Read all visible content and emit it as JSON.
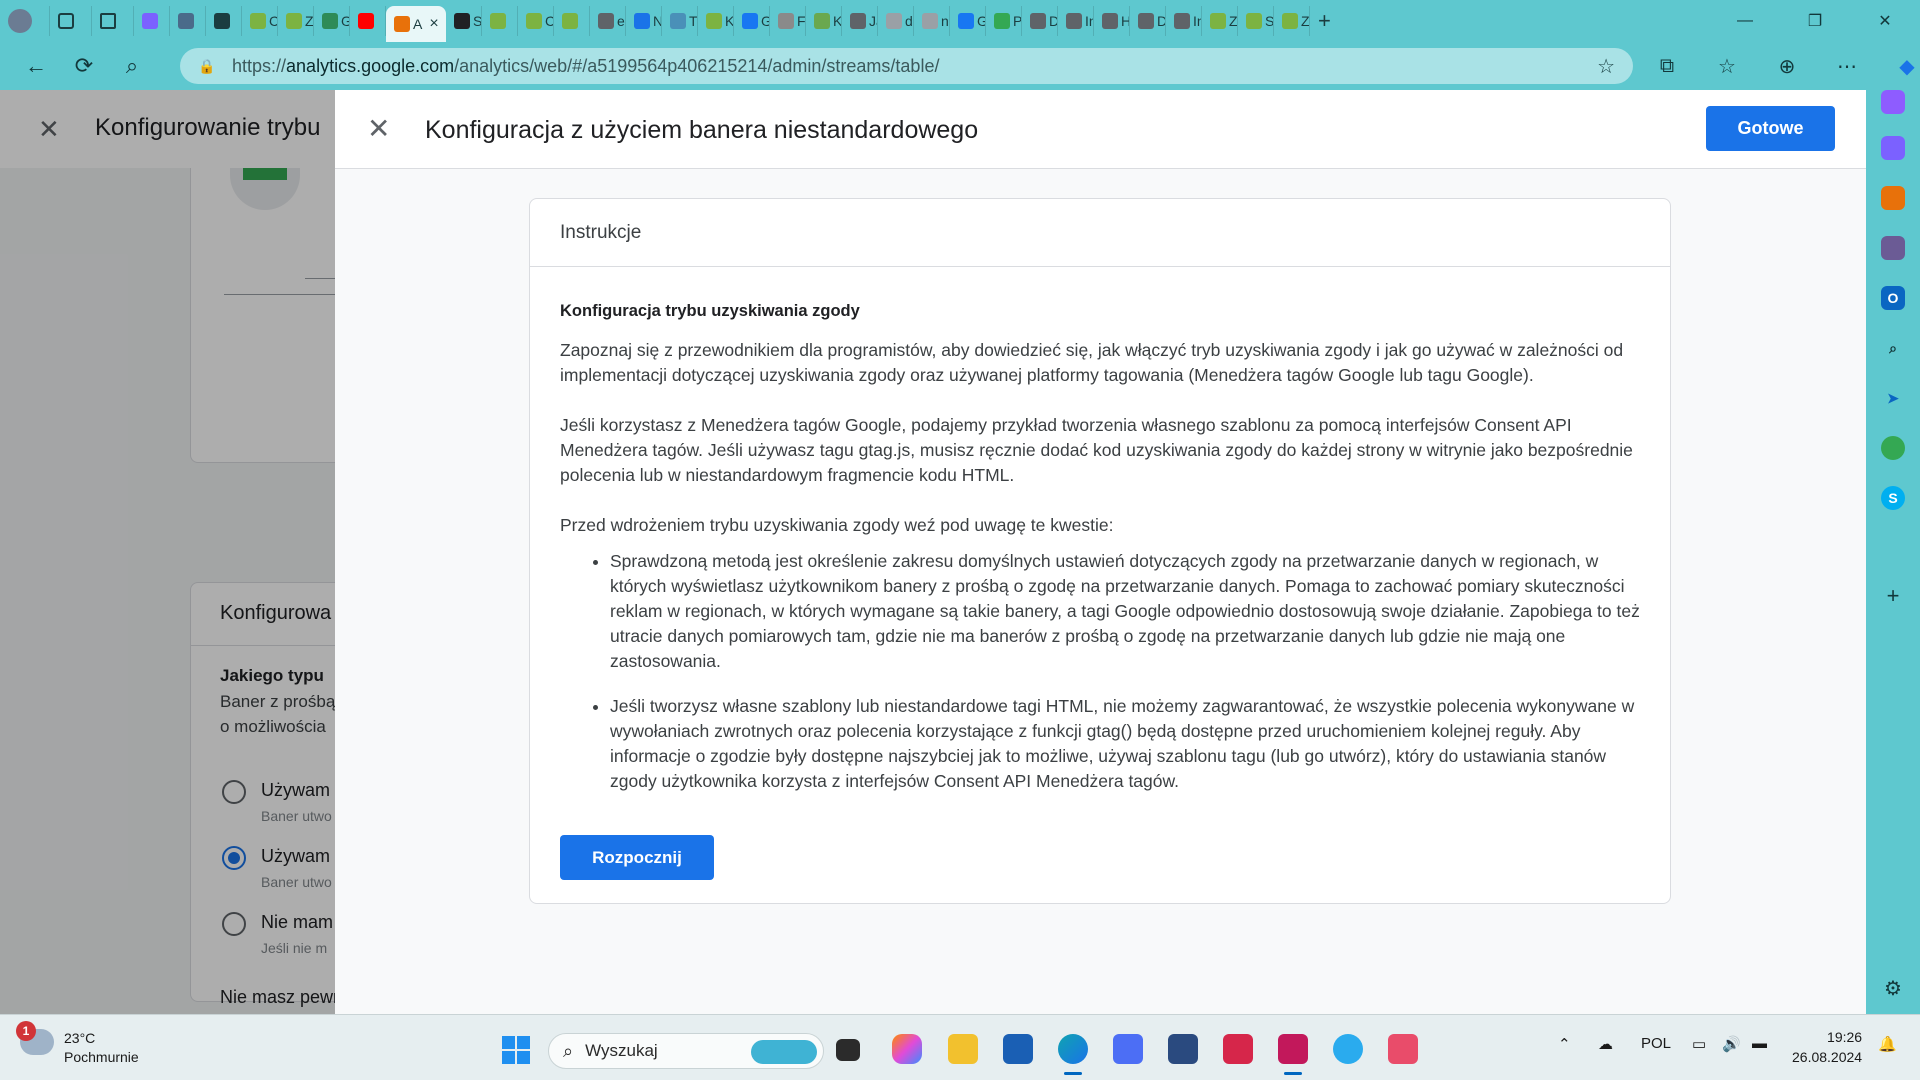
{
  "browser": {
    "url_prefix": "https://",
    "url_host": "analytics.google.com",
    "url_path": "/analytics/web/#/a5199564p406215214/admin/streams/table/",
    "tabs": [
      {
        "label": "",
        "color": "#7b61ff"
      },
      {
        "label": "",
        "color": "#4a6b8a"
      },
      {
        "label": "",
        "color": "#1b3d40"
      },
      {
        "label": "C",
        "color": "#7cb342"
      },
      {
        "label": "Z",
        "color": "#7cb342"
      },
      {
        "label": "G",
        "color": "#2e8b57"
      },
      {
        "label": "",
        "color": "#ff0000"
      },
      {
        "label": "A",
        "color": "#e8710a"
      },
      {
        "label": "S",
        "color": "#202124"
      },
      {
        "label": "",
        "color": "#7cb342"
      },
      {
        "label": "C",
        "color": "#7cb342"
      },
      {
        "label": "",
        "color": "#7cb342"
      },
      {
        "label": "e",
        "color": "#5f6368"
      },
      {
        "label": "N",
        "color": "#1a73e8"
      },
      {
        "label": "T",
        "color": "#4a90b8"
      },
      {
        "label": "K",
        "color": "#7cb342"
      },
      {
        "label": "G",
        "color": "#1877f2"
      },
      {
        "label": "F",
        "color": "#8a8a8a"
      },
      {
        "label": "K",
        "color": "#6aa84f"
      },
      {
        "label": "Ja",
        "color": "#5f6368"
      },
      {
        "label": "d",
        "color": "#9aa0a6"
      },
      {
        "label": "n",
        "color": "#9aa0a6"
      },
      {
        "label": "G",
        "color": "#1877f2"
      },
      {
        "label": "P",
        "color": "#34a853"
      },
      {
        "label": "D",
        "color": "#5f6368"
      },
      {
        "label": "In",
        "color": "#5f6368"
      },
      {
        "label": "H",
        "color": "#5f6368"
      },
      {
        "label": "D",
        "color": "#5f6368"
      },
      {
        "label": "In",
        "color": "#5f6368"
      },
      {
        "label": "Z",
        "color": "#7cb342"
      },
      {
        "label": "S",
        "color": "#7cb342"
      },
      {
        "label": "Z",
        "color": "#7cb342"
      }
    ],
    "active_tab": {
      "label": "A",
      "close": "×"
    },
    "new_tab": "+",
    "window_controls": {
      "minimize": "—",
      "maximize": "❐",
      "close": "✕"
    }
  },
  "background_page": {
    "title": "Konfigurowanie trybu",
    "card_title": "Konfigurowa",
    "question": "Jakiego typu",
    "desc_line1": "Baner z prośbą",
    "desc_line2": "o możliwościa",
    "options": [
      {
        "label": "Używam b",
        "sub": "Baner utwo",
        "checked": false
      },
      {
        "label": "Używam n",
        "sub": "Baner utwo",
        "checked": true
      },
      {
        "label": "Nie mam",
        "sub": "Jeśli nie m",
        "checked": false
      }
    ],
    "footer_text": "Nie masz pewn"
  },
  "panel": {
    "title": "Konfiguracja z użyciem banera niestandardowego",
    "done_label": "Gotowe",
    "card": {
      "header": "Instrukcje",
      "heading": "Konfiguracja trybu uzyskiwania zgody",
      "paragraphs": [
        "Zapoznaj się z przewodnikiem dla programistów, aby dowiedzieć się, jak włączyć tryb uzyskiwania zgody i jak go używać w zależności od implementacji dotyczącej uzyskiwania zgody oraz używanej platformy tagowania (Menedżera tagów Google lub tagu Google).",
        "Jeśli korzystasz z Menedżera tagów Google, podajemy przykład tworzenia własnego szablonu za pomocą interfejsów Consent API Menedżera tagów. Jeśli używasz tagu gtag.js, musisz ręcznie dodać kod uzyskiwania zgody do każdej strony w witrynie jako bezpośrednie polecenia lub w niestandardowym fragmencie kodu HTML.",
        "Przed wdrożeniem trybu uzyskiwania zgody weź pod uwagę te kwestie:"
      ],
      "bullets": [
        "Sprawdzoną metodą jest określenie zakresu domyślnych ustawień dotyczących zgody na przetwarzanie danych w regionach, w których wyświetlasz użytkownikom banery z prośbą o zgodę na przetwarzanie danych. Pomaga to zachować pomiary skuteczności reklam w regionach, w których wymagane są takie banery, a tagi Google odpowiednio dostosowują swoje działanie. Zapobiega to też utracie danych pomiarowych tam, gdzie nie ma banerów z prośbą o zgodę na przetwarzanie danych lub gdzie nie mają one zastosowania.",
        "Jeśli tworzysz własne szablony lub niestandardowe tagi HTML, nie możemy zagwarantować, że wszystkie polecenia wykonywane w wywołaniach zwrotnych oraz polecenia korzystające z funkcji gtag() będą dostępne przed uruchomieniem kolejnej reguły. Aby informacje o zgodzie były dostępne najszybciej jak to możliwe, używaj szablonu tagu (lub go utwórz), który do ustawiania stanów zgody użytkownika korzysta z interfejsów Consent API Menedżera tagów."
      ],
      "start_label": "Rozpocznij"
    }
  },
  "taskbar": {
    "weather_temp": "23°C",
    "weather_desc": "Pochmurnie",
    "weather_badge": "1",
    "search_placeholder": "Wyszukaj",
    "language": "POL",
    "time": "19:26",
    "date": "26.08.2024"
  },
  "colors": {
    "accent": "#1a73e8",
    "chrome": "#5ec8cf"
  }
}
